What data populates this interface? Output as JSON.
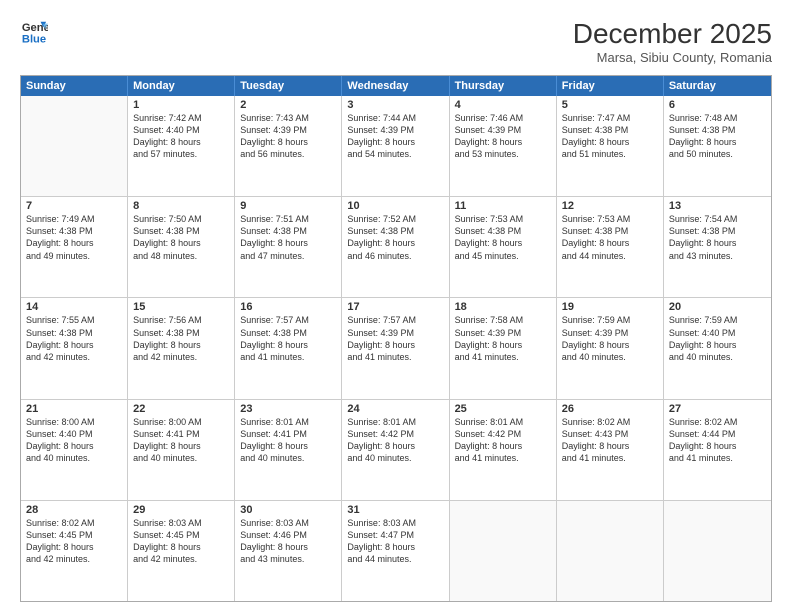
{
  "header": {
    "logo_line1": "General",
    "logo_line2": "Blue",
    "month_title": "December 2025",
    "subtitle": "Marsa, Sibiu County, Romania"
  },
  "days_of_week": [
    "Sunday",
    "Monday",
    "Tuesday",
    "Wednesday",
    "Thursday",
    "Friday",
    "Saturday"
  ],
  "weeks": [
    [
      {
        "day": "",
        "lines": []
      },
      {
        "day": "1",
        "lines": [
          "Sunrise: 7:42 AM",
          "Sunset: 4:40 PM",
          "Daylight: 8 hours",
          "and 57 minutes."
        ]
      },
      {
        "day": "2",
        "lines": [
          "Sunrise: 7:43 AM",
          "Sunset: 4:39 PM",
          "Daylight: 8 hours",
          "and 56 minutes."
        ]
      },
      {
        "day": "3",
        "lines": [
          "Sunrise: 7:44 AM",
          "Sunset: 4:39 PM",
          "Daylight: 8 hours",
          "and 54 minutes."
        ]
      },
      {
        "day": "4",
        "lines": [
          "Sunrise: 7:46 AM",
          "Sunset: 4:39 PM",
          "Daylight: 8 hours",
          "and 53 minutes."
        ]
      },
      {
        "day": "5",
        "lines": [
          "Sunrise: 7:47 AM",
          "Sunset: 4:38 PM",
          "Daylight: 8 hours",
          "and 51 minutes."
        ]
      },
      {
        "day": "6",
        "lines": [
          "Sunrise: 7:48 AM",
          "Sunset: 4:38 PM",
          "Daylight: 8 hours",
          "and 50 minutes."
        ]
      }
    ],
    [
      {
        "day": "7",
        "lines": [
          "Sunrise: 7:49 AM",
          "Sunset: 4:38 PM",
          "Daylight: 8 hours",
          "and 49 minutes."
        ]
      },
      {
        "day": "8",
        "lines": [
          "Sunrise: 7:50 AM",
          "Sunset: 4:38 PM",
          "Daylight: 8 hours",
          "and 48 minutes."
        ]
      },
      {
        "day": "9",
        "lines": [
          "Sunrise: 7:51 AM",
          "Sunset: 4:38 PM",
          "Daylight: 8 hours",
          "and 47 minutes."
        ]
      },
      {
        "day": "10",
        "lines": [
          "Sunrise: 7:52 AM",
          "Sunset: 4:38 PM",
          "Daylight: 8 hours",
          "and 46 minutes."
        ]
      },
      {
        "day": "11",
        "lines": [
          "Sunrise: 7:53 AM",
          "Sunset: 4:38 PM",
          "Daylight: 8 hours",
          "and 45 minutes."
        ]
      },
      {
        "day": "12",
        "lines": [
          "Sunrise: 7:53 AM",
          "Sunset: 4:38 PM",
          "Daylight: 8 hours",
          "and 44 minutes."
        ]
      },
      {
        "day": "13",
        "lines": [
          "Sunrise: 7:54 AM",
          "Sunset: 4:38 PM",
          "Daylight: 8 hours",
          "and 43 minutes."
        ]
      }
    ],
    [
      {
        "day": "14",
        "lines": [
          "Sunrise: 7:55 AM",
          "Sunset: 4:38 PM",
          "Daylight: 8 hours",
          "and 42 minutes."
        ]
      },
      {
        "day": "15",
        "lines": [
          "Sunrise: 7:56 AM",
          "Sunset: 4:38 PM",
          "Daylight: 8 hours",
          "and 42 minutes."
        ]
      },
      {
        "day": "16",
        "lines": [
          "Sunrise: 7:57 AM",
          "Sunset: 4:38 PM",
          "Daylight: 8 hours",
          "and 41 minutes."
        ]
      },
      {
        "day": "17",
        "lines": [
          "Sunrise: 7:57 AM",
          "Sunset: 4:39 PM",
          "Daylight: 8 hours",
          "and 41 minutes."
        ]
      },
      {
        "day": "18",
        "lines": [
          "Sunrise: 7:58 AM",
          "Sunset: 4:39 PM",
          "Daylight: 8 hours",
          "and 41 minutes."
        ]
      },
      {
        "day": "19",
        "lines": [
          "Sunrise: 7:59 AM",
          "Sunset: 4:39 PM",
          "Daylight: 8 hours",
          "and 40 minutes."
        ]
      },
      {
        "day": "20",
        "lines": [
          "Sunrise: 7:59 AM",
          "Sunset: 4:40 PM",
          "Daylight: 8 hours",
          "and 40 minutes."
        ]
      }
    ],
    [
      {
        "day": "21",
        "lines": [
          "Sunrise: 8:00 AM",
          "Sunset: 4:40 PM",
          "Daylight: 8 hours",
          "and 40 minutes."
        ]
      },
      {
        "day": "22",
        "lines": [
          "Sunrise: 8:00 AM",
          "Sunset: 4:41 PM",
          "Daylight: 8 hours",
          "and 40 minutes."
        ]
      },
      {
        "day": "23",
        "lines": [
          "Sunrise: 8:01 AM",
          "Sunset: 4:41 PM",
          "Daylight: 8 hours",
          "and 40 minutes."
        ]
      },
      {
        "day": "24",
        "lines": [
          "Sunrise: 8:01 AM",
          "Sunset: 4:42 PM",
          "Daylight: 8 hours",
          "and 40 minutes."
        ]
      },
      {
        "day": "25",
        "lines": [
          "Sunrise: 8:01 AM",
          "Sunset: 4:42 PM",
          "Daylight: 8 hours",
          "and 41 minutes."
        ]
      },
      {
        "day": "26",
        "lines": [
          "Sunrise: 8:02 AM",
          "Sunset: 4:43 PM",
          "Daylight: 8 hours",
          "and 41 minutes."
        ]
      },
      {
        "day": "27",
        "lines": [
          "Sunrise: 8:02 AM",
          "Sunset: 4:44 PM",
          "Daylight: 8 hours",
          "and 41 minutes."
        ]
      }
    ],
    [
      {
        "day": "28",
        "lines": [
          "Sunrise: 8:02 AM",
          "Sunset: 4:45 PM",
          "Daylight: 8 hours",
          "and 42 minutes."
        ]
      },
      {
        "day": "29",
        "lines": [
          "Sunrise: 8:03 AM",
          "Sunset: 4:45 PM",
          "Daylight: 8 hours",
          "and 42 minutes."
        ]
      },
      {
        "day": "30",
        "lines": [
          "Sunrise: 8:03 AM",
          "Sunset: 4:46 PM",
          "Daylight: 8 hours",
          "and 43 minutes."
        ]
      },
      {
        "day": "31",
        "lines": [
          "Sunrise: 8:03 AM",
          "Sunset: 4:47 PM",
          "Daylight: 8 hours",
          "and 44 minutes."
        ]
      },
      {
        "day": "",
        "lines": []
      },
      {
        "day": "",
        "lines": []
      },
      {
        "day": "",
        "lines": []
      }
    ]
  ]
}
